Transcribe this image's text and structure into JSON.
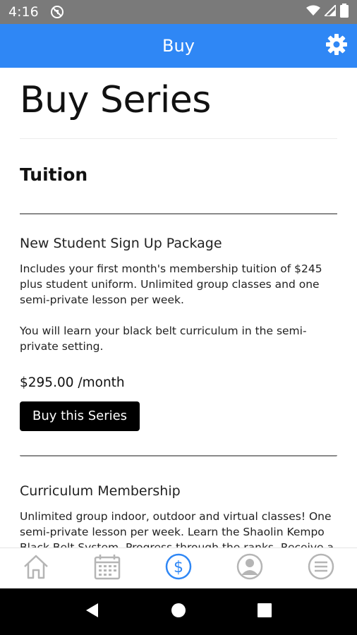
{
  "status_bar": {
    "time": "4:16",
    "icons": [
      "cast-off-icon",
      "wifi-icon",
      "signal-icon",
      "battery-icon"
    ]
  },
  "app_bar": {
    "title": "Buy",
    "settings_icon": "gear-icon",
    "background": "#2f87f5"
  },
  "page": {
    "title": "Buy Series"
  },
  "section": {
    "title": "Tuition"
  },
  "items": [
    {
      "name": "New Student Sign Up Package",
      "description": [
        "Includes your first month's membership tuition of $245 plus student uniform. Unlimited group classes and one semi-private lesson per week.",
        "You will learn your black belt curriculum in the semi-private setting."
      ],
      "price": "$295.00 /month",
      "button_label": "Buy this Series"
    },
    {
      "name": "Curriculum Membership",
      "description": [
        "Unlimited group indoor, outdoor and virtual classes! One semi-private lesson per week. Learn the Shaolin Kempo Black Belt System. Progress through the ranks. Receive a"
      ]
    }
  ],
  "bottom_nav": [
    {
      "icon": "home-icon",
      "active": false
    },
    {
      "icon": "calendar-icon",
      "active": false
    },
    {
      "icon": "dollar-icon",
      "active": true
    },
    {
      "icon": "profile-icon",
      "active": false
    },
    {
      "icon": "menu-icon",
      "active": false
    }
  ],
  "colors": {
    "accent": "#2f87f5",
    "nav_inactive": "#b5b5b5"
  }
}
